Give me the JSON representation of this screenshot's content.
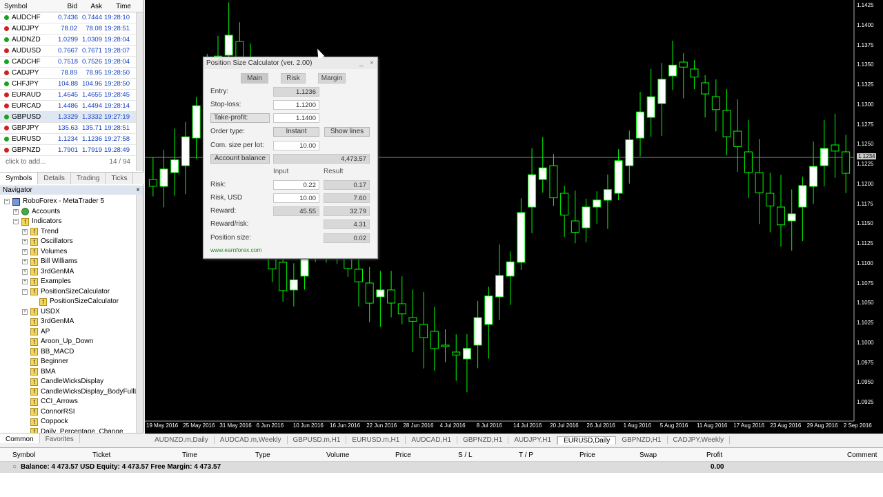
{
  "market_watch": {
    "headers": {
      "symbol": "Symbol",
      "bid": "Bid",
      "ask": "Ask",
      "time": "Time"
    },
    "rows": [
      {
        "symbol": "AUDCHF",
        "bid": "0.7436",
        "ask": "0.7444",
        "time": "19:28:10",
        "dir": "up"
      },
      {
        "symbol": "AUDJPY",
        "bid": "78.02",
        "ask": "78.08",
        "time": "19:28:51",
        "dir": "dn"
      },
      {
        "symbol": "AUDNZD",
        "bid": "1.0299",
        "ask": "1.0309",
        "time": "19:28:04",
        "dir": "up"
      },
      {
        "symbol": "AUDUSD",
        "bid": "0.7667",
        "ask": "0.7671",
        "time": "19:28:07",
        "dir": "dn"
      },
      {
        "symbol": "CADCHF",
        "bid": "0.7518",
        "ask": "0.7526",
        "time": "19:28:04",
        "dir": "up"
      },
      {
        "symbol": "CADJPY",
        "bid": "78.89",
        "ask": "78.95",
        "time": "19:28:50",
        "dir": "dn"
      },
      {
        "symbol": "CHFJPY",
        "bid": "104.88",
        "ask": "104.96",
        "time": "19:28:50",
        "dir": "up"
      },
      {
        "symbol": "EURAUD",
        "bid": "1.4645",
        "ask": "1.4655",
        "time": "19:28:45",
        "dir": "dn"
      },
      {
        "symbol": "EURCAD",
        "bid": "1.4486",
        "ask": "1.4494",
        "time": "19:28:14",
        "dir": "dn"
      },
      {
        "symbol": "GBPUSD",
        "bid": "1.3329",
        "ask": "1.3332",
        "time": "19:27:19",
        "dir": "up",
        "selected": true
      },
      {
        "symbol": "GBPJPY",
        "bid": "135.63",
        "ask": "135.71",
        "time": "19:28:51",
        "dir": "dn"
      },
      {
        "symbol": "EURUSD",
        "bid": "1.1234",
        "ask": "1.1236",
        "time": "19:27:58",
        "dir": "up"
      },
      {
        "symbol": "GBPNZD",
        "bid": "1.7901",
        "ask": "1.7919",
        "time": "19:28:49",
        "dir": "dn"
      }
    ],
    "add_text": "click to add...",
    "count": "14 / 94",
    "tabs": [
      "Symbols",
      "Details",
      "Trading",
      "Ticks"
    ]
  },
  "navigator": {
    "title": "Navigator",
    "items": [
      {
        "label": "RoboForex - MetaTrader 5",
        "icon": "terminal-icon",
        "pm": "−"
      },
      {
        "label": "Accounts",
        "icon": "accounts-icon",
        "pm": "+"
      },
      {
        "label": "Indicators",
        "icon": "indicators-folder-icon",
        "pm": "−"
      },
      {
        "label": "Trend",
        "icon": "folder-icon",
        "pm": "+"
      },
      {
        "label": "Oscillators",
        "icon": "folder-icon",
        "pm": "+"
      },
      {
        "label": "Volumes",
        "icon": "folder-icon",
        "pm": "+"
      },
      {
        "label": "Bill Williams",
        "icon": "folder-icon",
        "pm": "+"
      },
      {
        "label": "3rdGenMA",
        "icon": "folder-icon",
        "pm": "+"
      },
      {
        "label": "Examples",
        "icon": "folder-icon",
        "pm": "+"
      },
      {
        "label": "PositionSizeCalculator",
        "icon": "folder-icon",
        "pm": "−"
      },
      {
        "label": "PositionSizeCalculator",
        "icon": "indicator-icon",
        "pm": ""
      },
      {
        "label": "USDX",
        "icon": "folder-icon",
        "pm": "+"
      },
      {
        "label": "3rdGenMA",
        "icon": "indicator-icon",
        "pm": ""
      },
      {
        "label": "AP",
        "icon": "indicator-icon",
        "pm": ""
      },
      {
        "label": "Aroon_Up_Down",
        "icon": "indicator-icon",
        "pm": ""
      },
      {
        "label": "BB_MACD",
        "icon": "indicator-icon",
        "pm": ""
      },
      {
        "label": "Beginner",
        "icon": "indicator-icon",
        "pm": ""
      },
      {
        "label": "BMA",
        "icon": "indicator-icon",
        "pm": ""
      },
      {
        "label": "CandleWicksDisplay",
        "icon": "indicator-icon",
        "pm": ""
      },
      {
        "label": "CandleWicksDisplay_BodyFullLe",
        "icon": "indicator-icon",
        "pm": ""
      },
      {
        "label": "CCI_Arrows",
        "icon": "indicator-icon",
        "pm": ""
      },
      {
        "label": "ConnorRSI",
        "icon": "indicator-icon",
        "pm": ""
      },
      {
        "label": "Coppock",
        "icon": "indicator-icon",
        "pm": ""
      },
      {
        "label": "Daily_Percentage_Change",
        "icon": "indicator-icon",
        "pm": ""
      }
    ],
    "tabs": [
      "Common",
      "Favorites"
    ]
  },
  "chart": {
    "price_labels": [
      "1.1425",
      "1.1400",
      "1.1375",
      "1.1350",
      "1.1325",
      "1.1300",
      "1.1275",
      "1.1250",
      "1.1225",
      "1.1200",
      "1.1175",
      "1.1150",
      "1.1125",
      "1.1100",
      "1.1075",
      "1.1050",
      "1.1025",
      "1.1000",
      "1.0975",
      "1.0950",
      "1.0925"
    ],
    "current_price": "1.1234",
    "date_labels": [
      "19 May 2016",
      "25 May 2016",
      "31 May 2016",
      "6 Jun 2016",
      "10 Jun 2016",
      "16 Jun 2016",
      "22 Jun 2016",
      "28 Jun 2016",
      "4 Jul 2016",
      "8 Jul 2016",
      "14 Jul 2016",
      "20 Jul 2016",
      "26 Jul 2016",
      "1 Aug 2016",
      "5 Aug 2016",
      "11 Aug 2016",
      "17 Aug 2016",
      "23 Aug 2016",
      "29 Aug 2016",
      "2 Sep 2016"
    ],
    "up_color": "#ffffff",
    "wick_color": "#00ff00",
    "bg_color": "#000000"
  },
  "chart_tabs": [
    "AUDNZD.m,Daily",
    "AUDCAD.m,Weekly",
    "GBPUSD.m,H1",
    "EURUSD.m,H1",
    "AUDCAD,H1",
    "GBPNZD,H1",
    "AUDJPY,H1",
    "EURUSD,Daily",
    "GBPNZD,H1",
    "CADJPY,Weekly"
  ],
  "active_chart_tab": "EURUSD,Daily",
  "trade": {
    "headers": {
      "symbol": "Symbol",
      "ticket": "Ticket",
      "time": "Time",
      "type": "Type",
      "volume": "Volume",
      "price": "Price",
      "sl": "S / L",
      "tp": "T / P",
      "price2": "Price",
      "swap": "Swap",
      "profit": "Profit",
      "comment": "Comment"
    },
    "balance_text": "Balance: 4 473.57 USD  Equity: 4 473.57  Free Margin: 4 473.57",
    "profit": "0.00"
  },
  "psc": {
    "title": "Position Size Calculator (ver. 2.00)",
    "tabs": [
      "Main",
      "Risk",
      "Margin"
    ],
    "entry_label": "Entry:",
    "entry": "1.1236",
    "stoploss_label": "Stop-loss:",
    "stoploss": "1.1200",
    "takeprofit_label": "Take-profit:",
    "takeprofit": "1.1400",
    "order_type_label": "Order type:",
    "order_type": "Instant",
    "show_lines": "Show lines",
    "commission_label": "Com. size per lot:",
    "commission": "10.00",
    "account_balance_label": "Account balance",
    "account_balance": "4,473.57",
    "col_input": "Input",
    "col_result": "Result",
    "risk_label": "Risk:",
    "risk_input": "0.22",
    "risk_result": "0.17",
    "risk_usd_label": "Risk, USD",
    "risk_usd_input": "10.00",
    "risk_usd_result": "7.60",
    "reward_label": "Reward:",
    "reward_input": "45.55",
    "reward_result": "32.79",
    "reward_risk_label": "Reward/risk:",
    "reward_risk": "4.31",
    "position_size_label": "Position size:",
    "position_size": "0.02",
    "link": "www.earnforex.com"
  }
}
